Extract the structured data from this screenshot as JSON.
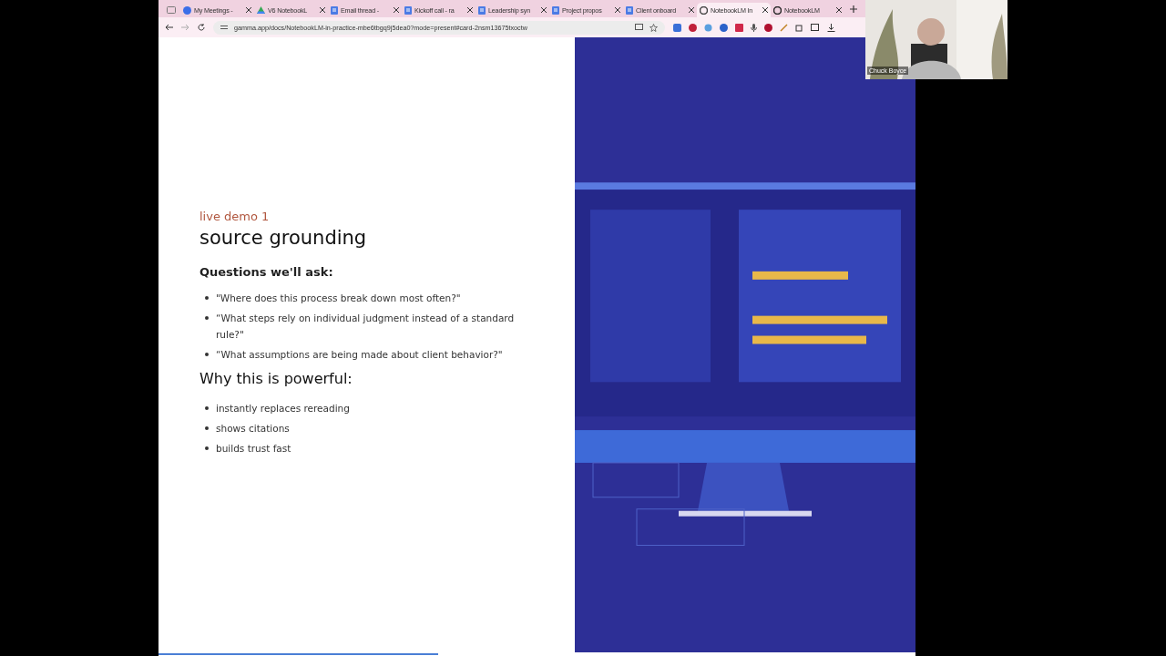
{
  "browser": {
    "tabs": [
      {
        "kind": "group",
        "selected": false
      },
      {
        "kind": "meet",
        "title": "My Meetings -",
        "selected": false
      },
      {
        "kind": "drive",
        "title": "V6 NotebookL",
        "selected": false
      },
      {
        "kind": "doc",
        "title": "Email thread -",
        "selected": false
      },
      {
        "kind": "doc",
        "title": "Kickoff call - ra",
        "selected": false
      },
      {
        "kind": "doc",
        "title": "Leadership syn",
        "selected": false
      },
      {
        "kind": "doc",
        "title": "Project propos",
        "selected": false
      },
      {
        "kind": "doc",
        "title": "Client onboard",
        "selected": false
      },
      {
        "kind": "gamma",
        "title": "NotebookLM In",
        "selected": true
      },
      {
        "kind": "notebook",
        "title": "NotebookLM",
        "selected": false
      }
    ],
    "url": "gamma.app/docs/NotebookLM-in-practice-mbe6tbgq9j5dea0?mode=present#card-2nsm13675txoctw"
  },
  "slide": {
    "eyebrow": "live demo 1",
    "title": "source grounding",
    "questions_heading": "Questions we'll ask:",
    "questions": [
      "\"Where does this process break down most often?\"",
      "“What steps rely on individual judgment instead of a standard rule?\"",
      "“What assumptions are being made about client behavior?\""
    ],
    "why_heading": "Why this is powerful:",
    "reasons": [
      "instantly replaces rereading",
      "shows citations",
      "builds trust fast"
    ]
  },
  "progress": {
    "level": 0.37
  },
  "video_call": {
    "participant": "Chuck Boyce"
  }
}
